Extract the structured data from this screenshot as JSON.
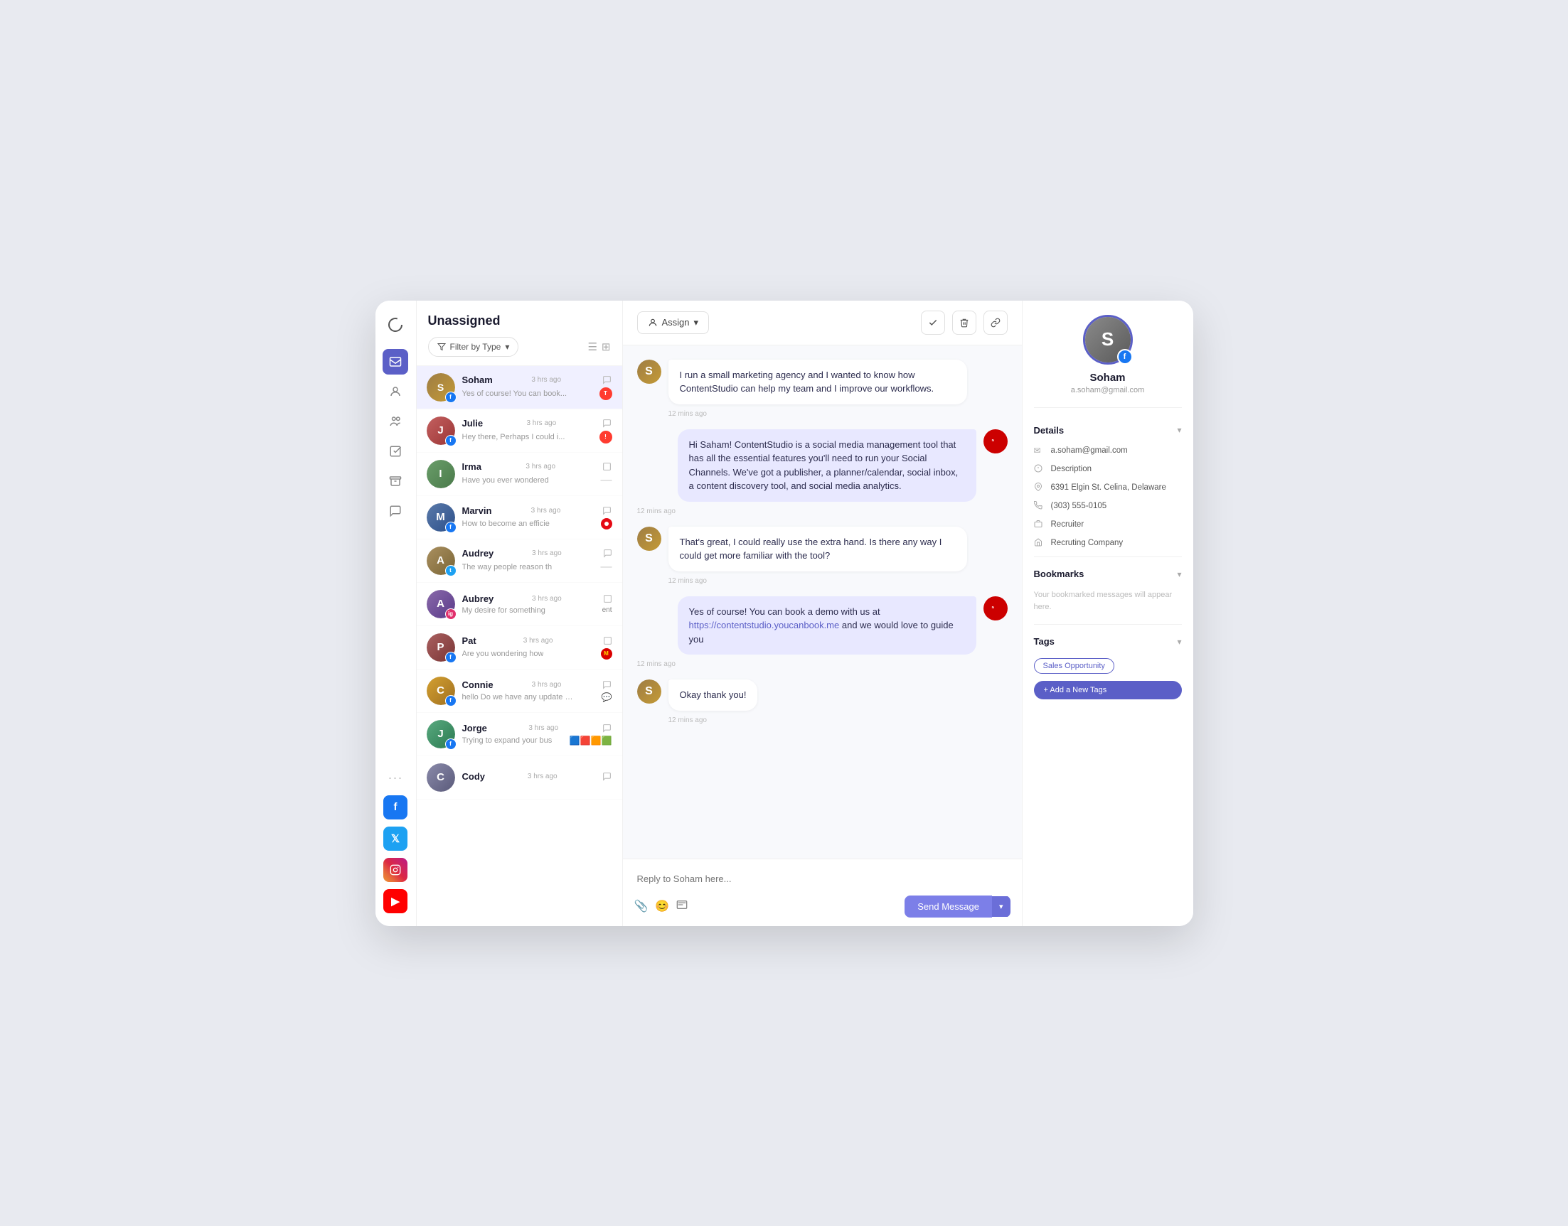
{
  "app": {
    "title": "Unassigned"
  },
  "nav": {
    "logo_icon": "↻",
    "items": [
      {
        "id": "inbox",
        "icon": "✉",
        "active": true
      },
      {
        "id": "contacts",
        "icon": "👤"
      },
      {
        "id": "team",
        "icon": "👥"
      },
      {
        "id": "tasks",
        "icon": "☑"
      },
      {
        "id": "archive",
        "icon": "🗃"
      },
      {
        "id": "chat",
        "icon": "💬"
      }
    ],
    "social_channels": [
      {
        "id": "facebook",
        "label": "f",
        "class": "social-fb"
      },
      {
        "id": "twitter",
        "label": "t",
        "class": "social-tw"
      },
      {
        "id": "instagram",
        "label": "ig",
        "class": "social-ig"
      },
      {
        "id": "youtube",
        "label": "▶",
        "class": "social-yt"
      }
    ]
  },
  "conv_list": {
    "title": "Unassigned",
    "filter_label": "Filter by Type",
    "conversations": [
      {
        "id": 1,
        "name": "Soham",
        "preview": "Yes of course! You can book...",
        "time": "3 hrs ago",
        "social": "fb",
        "indicator": "chat",
        "active": true,
        "color": "#8b6914"
      },
      {
        "id": 2,
        "name": "Julie",
        "preview": "Hey there, Perhaps I could i...",
        "time": "3 hrs ago",
        "social": "fb",
        "indicator": "red",
        "color": "#b35c5c"
      },
      {
        "id": 3,
        "name": "Irma",
        "preview": "Have you ever wondered",
        "time": "3 hrs ago",
        "social": "none",
        "indicator": "dash",
        "color": "#5a8a5a"
      },
      {
        "id": 4,
        "name": "Marvin",
        "preview": "How to become an efficie",
        "time": "3 hrs ago",
        "social": "fb",
        "indicator": "red-n",
        "color": "#4a6b8b"
      },
      {
        "id": 5,
        "name": "Audrey",
        "preview": "The way people reason th",
        "time": "3 hrs ago",
        "social": "tw",
        "indicator": "dash",
        "color": "#8b7355"
      },
      {
        "id": 6,
        "name": "Aubrey",
        "preview": "My desire for something",
        "time": "3 hrs ago",
        "social": "ig",
        "indicator": "ent",
        "color": "#7a5a9a"
      },
      {
        "id": 7,
        "name": "Pat",
        "preview": "Are you wondering how",
        "time": "3 hrs ago",
        "social": "fb",
        "indicator": "mc",
        "color": "#8b4a4a"
      },
      {
        "id": 8,
        "name": "Connie",
        "preview": "hello Do we have any update h...",
        "time": "3 hrs ago",
        "social": "fb",
        "indicator": "chat",
        "color": "#c4922a"
      },
      {
        "id": 9,
        "name": "Jorge",
        "preview": "Trying to expand your bus",
        "time": "3 hrs ago",
        "social": "fb",
        "indicator": "multi",
        "color": "#4a8b6b"
      },
      {
        "id": 10,
        "name": "Cody",
        "preview": "",
        "time": "3 hrs ago",
        "social": "none",
        "indicator": "chat",
        "color": "#7a7a8b"
      }
    ]
  },
  "chat": {
    "assign_label": "Assign",
    "messages": [
      {
        "id": 1,
        "type": "incoming",
        "text": "I run a small marketing agency and I wanted to know how ContentStudio can help my team and I improve our workflows.",
        "time": "12 mins ago"
      },
      {
        "id": 2,
        "type": "outgoing",
        "text": "Hi Saham! ContentStudio is a social media management tool that has all the essential features you'll need to run your Social Channels. We've got a publisher, a planner/calendar, social inbox, a content discovery tool, and social media analytics.",
        "time": "12 mins ago"
      },
      {
        "id": 3,
        "type": "incoming",
        "text": "That's great, I could really use the extra hand. Is there any way I could get more familiar with the tool?",
        "time": "12 mins ago"
      },
      {
        "id": 4,
        "type": "outgoing",
        "text_parts": [
          {
            "text": "Yes of course! You can book a demo with us at "
          },
          {
            "link": "https://contentstudio.youcanbook.me",
            "href": "https://contentstudio.youcanbook.me"
          },
          {
            "text": " and we would love to guide you"
          }
        ],
        "time": "12 mins ago"
      },
      {
        "id": 5,
        "type": "incoming",
        "text": "Okay thank you!",
        "time": "12 mins ago"
      }
    ],
    "reply_placeholder": "Reply to Soham here...",
    "send_label": "Send Message"
  },
  "right_panel": {
    "contact": {
      "name": "Soham",
      "email": "a.soham@gmail.com"
    },
    "details_title": "Details",
    "details": [
      {
        "icon": "✉",
        "text": "a.soham@gmail.com"
      },
      {
        "icon": "○",
        "text": "Description"
      },
      {
        "icon": "📍",
        "text": "6391 Elgin St. Celina, Delaware"
      },
      {
        "icon": "📞",
        "text": "(303) 555-0105"
      },
      {
        "icon": "💼",
        "text": "Recruiter"
      },
      {
        "icon": "🏢",
        "text": "Recruting Company"
      }
    ],
    "bookmarks_title": "Bookmarks",
    "bookmarks_empty": "Your bookmarked messages will appear here.",
    "tags_title": "Tags",
    "tags": [
      "Sales Opportunity"
    ],
    "add_tag_label": "+ Add a New Tags"
  }
}
